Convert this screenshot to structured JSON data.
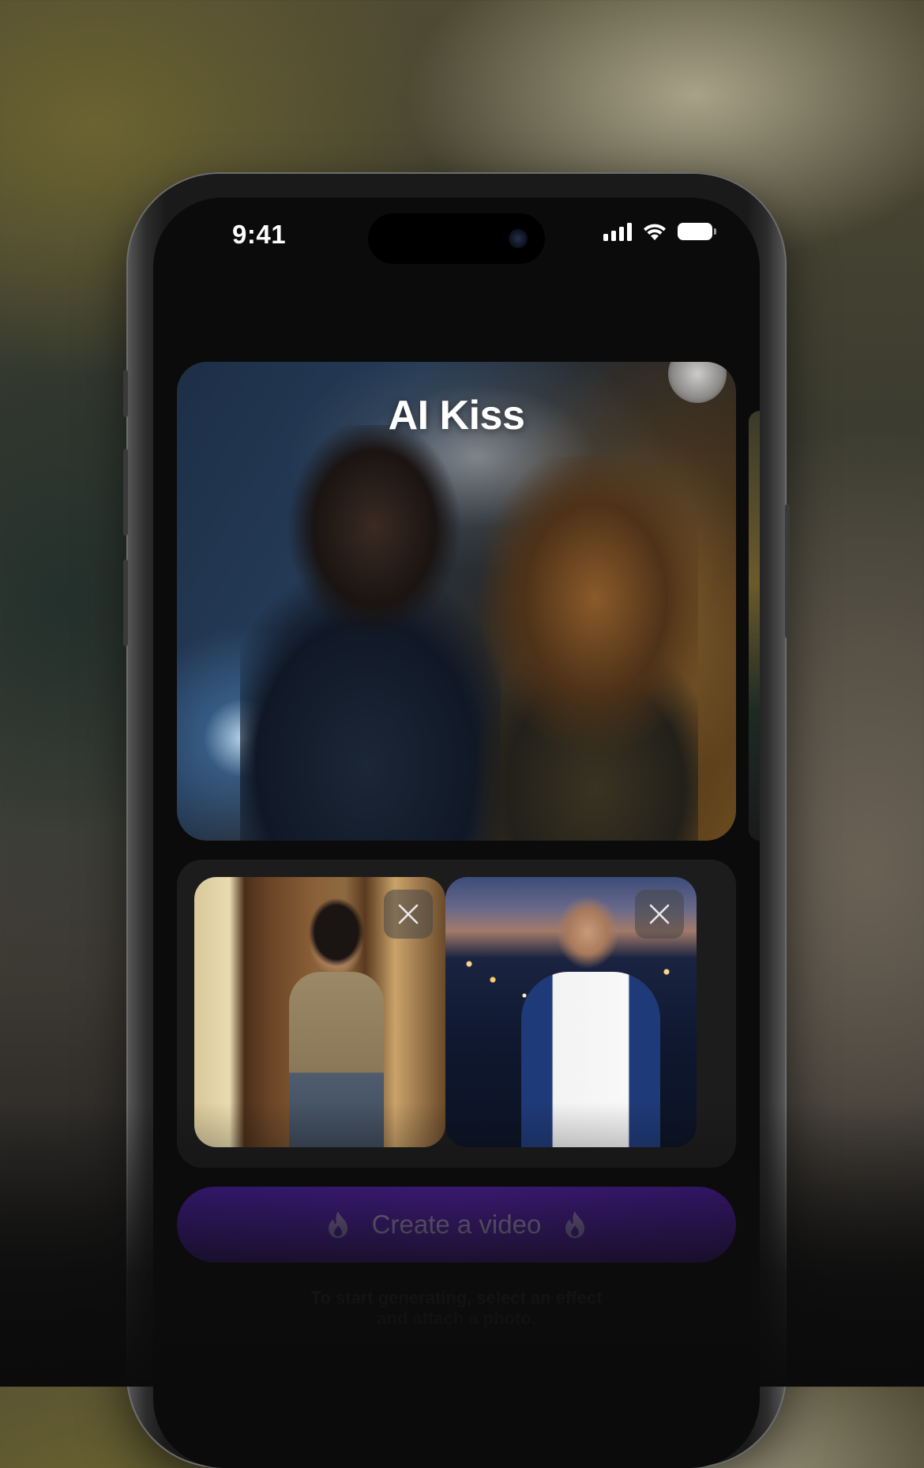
{
  "status_bar": {
    "time": "9:41",
    "icons": [
      "cellular-signal-icon",
      "wifi-icon",
      "battery-icon"
    ]
  },
  "effect": {
    "title": "AI Kiss"
  },
  "photos": [
    {
      "remove_icon": "close-icon"
    },
    {
      "remove_icon": "close-icon"
    }
  ],
  "create_button": {
    "label": "Create a video",
    "icon": "flame-icon"
  },
  "hint": {
    "line1": "To start generating, select an effect",
    "line2": "and attach a photo."
  },
  "colors": {
    "accent": "#5a22b8",
    "button_text": "#b9a8d8",
    "screen_bg": "#0b0b0b",
    "panel_bg": "#1c1c1c"
  }
}
